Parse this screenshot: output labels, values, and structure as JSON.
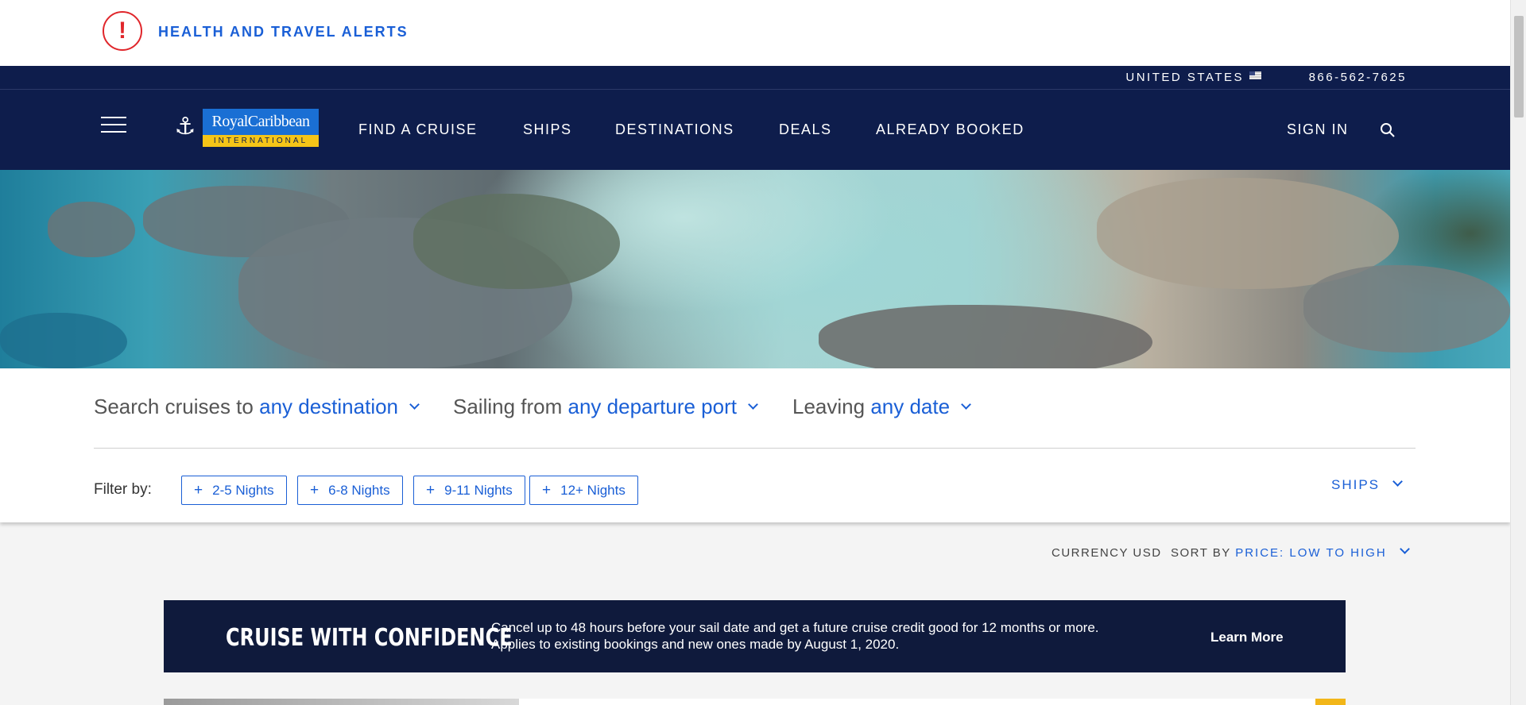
{
  "alert": {
    "icon": "!",
    "text": "HEALTH AND TRAVEL ALERTS"
  },
  "header": {
    "country": "UNITED STATES",
    "phone": "866-562-7625",
    "logo": {
      "icon": "⚓",
      "brand": "RoyalCaribbean",
      "sub": "INTERNATIONAL"
    },
    "nav": [
      "FIND A CRUISE",
      "SHIPS",
      "DESTINATIONS",
      "DEALS",
      "ALREADY BOOKED"
    ],
    "sign_in": "SIGN IN",
    "icons": {
      "menu": "hamburger-icon",
      "search": "search-icon",
      "flag": "us-flag-icon"
    }
  },
  "search": {
    "dest_prefix": "Search cruises to",
    "dest_value": "any destination",
    "port_prefix": "Sailing from",
    "port_value": "any departure port",
    "date_prefix": "Leaving",
    "date_value": "any date"
  },
  "filters": {
    "label": "Filter by:",
    "chips": [
      "2-5 Nights",
      "6-8 Nights",
      "9-11 Nights",
      "12+ Nights"
    ],
    "ships": "SHIPS"
  },
  "sort": {
    "currency": "CURRENCY USD",
    "sort_prefix": "SORT BY",
    "sort_value": "PRICE: LOW TO HIGH"
  },
  "banner": {
    "title": "CRUISE WITH CONFIDENCE",
    "line1": "Cancel up to 48 hours before your sail date and get a future cruise credit good for 12 months or more.",
    "line2": "Applies to existing bookings and new ones made by August 1, 2020.",
    "cta": "Learn More"
  },
  "colors": {
    "navy": "#0e1d4c",
    "accent": "#1a5fd6",
    "alert": "#e0262b",
    "banner": "#0f1a3c",
    "gold": "#f5c518"
  }
}
